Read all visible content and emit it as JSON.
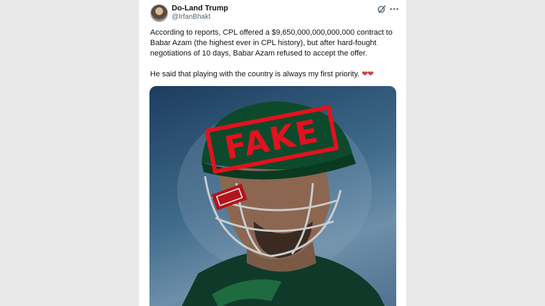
{
  "author": {
    "display_name": "Do-Land Trump",
    "handle": "@IrfanBhakt"
  },
  "post": {
    "paragraph_1": "According to reports, CPL offered a $9,650,000,000,000,000 contract to Babar Azam (the highest ever in CPL history), but after hard-fought negotiations of 10 days, Babar Azam refused to accept the offer.",
    "paragraph_2": "He said that playing with the country is always my first priority.",
    "emoji": "❤❤"
  },
  "media": {
    "stamp_text": "FAKE"
  },
  "icons": {
    "header_left": "grok-icon",
    "header_right": "more-icon"
  },
  "colors": {
    "stamp": "#e2121f",
    "text": "#0f1419",
    "muted": "#536471",
    "heart": "#d13a48"
  }
}
